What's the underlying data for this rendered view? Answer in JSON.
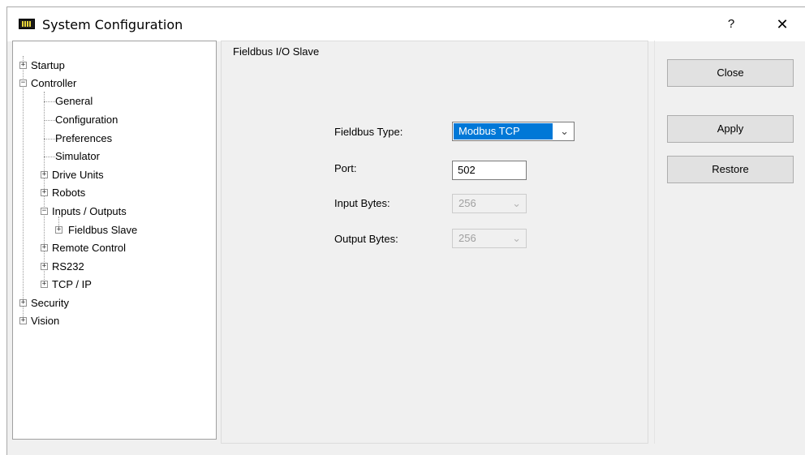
{
  "window": {
    "title": "System Configuration",
    "help_label": "?",
    "close_label": "✕"
  },
  "icons": {
    "app": "monitor-icon",
    "expand": "plus-box-icon",
    "collapse": "minus-box-icon"
  },
  "tree": {
    "startup": "Startup",
    "controller": "Controller",
    "general": "General",
    "configuration": "Configuration",
    "preferences": "Preferences",
    "simulator": "Simulator",
    "drive_units": "Drive Units",
    "robots": "Robots",
    "inputs_outputs": "Inputs / Outputs",
    "fieldbus_slave": "Fieldbus Slave",
    "remote_control": "Remote Control",
    "rs232": "RS232",
    "tcp_ip": "TCP / IP",
    "security": "Security",
    "vision": "Vision",
    "expanded_glyph": "−",
    "collapsed_glyph": "+"
  },
  "panel": {
    "title": "Fieldbus I/O Slave",
    "fieldbus_type_label": "Fieldbus Type:",
    "fieldbus_type_value": "Modbus TCP",
    "port_label": "Port:",
    "port_value": "502",
    "input_bytes_label": "Input Bytes:",
    "input_bytes_value": "256",
    "output_bytes_label": "Output Bytes:",
    "output_bytes_value": "256",
    "dropdown_arrow": "⌄"
  },
  "buttons": {
    "close": "Close",
    "apply": "Apply",
    "restore": "Restore"
  },
  "colors": {
    "selection": "#0078d7",
    "window_bg": "#f0f0f0",
    "button_bg": "#e1e1e1"
  }
}
